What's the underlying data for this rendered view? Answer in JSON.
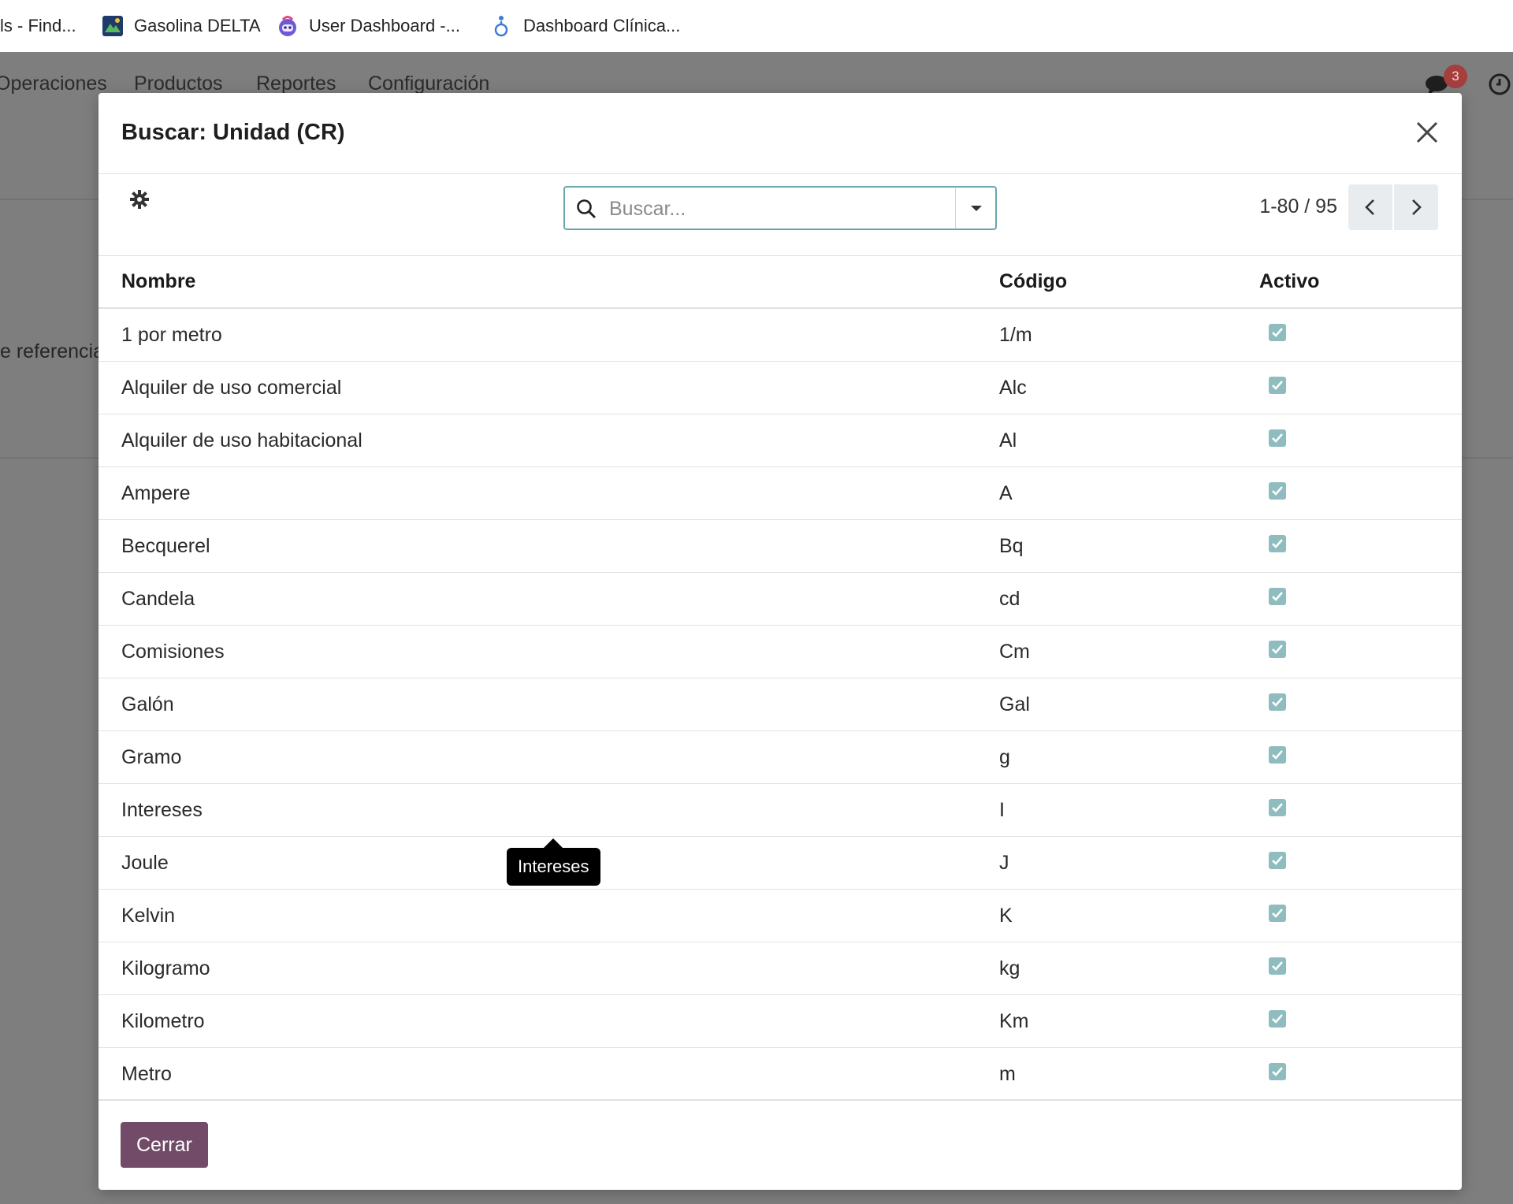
{
  "browser": {
    "bookmarks": [
      {
        "label": "ls - Find..."
      },
      {
        "label": "Gasolina DELTA"
      },
      {
        "label": "User Dashboard -..."
      },
      {
        "label": "Dashboard Clínica..."
      }
    ]
  },
  "app": {
    "menu": [
      "Operaciones",
      "Productos",
      "Reportes",
      "Configuración"
    ],
    "notification_count": "3",
    "background_text": "e referencia"
  },
  "dialog": {
    "title": "Buscar: Unidad (CR)",
    "search_placeholder": "Buscar...",
    "pager": "1-80 / 95",
    "columns": {
      "name": "Nombre",
      "code": "Código",
      "active": "Activo"
    },
    "rows": [
      {
        "name": "1 por metro",
        "code": "1/m",
        "active": true
      },
      {
        "name": "Alquiler de uso comercial",
        "code": "Alc",
        "active": true
      },
      {
        "name": "Alquiler de uso habitacional",
        "code": "Al",
        "active": true
      },
      {
        "name": "Ampere",
        "code": "A",
        "active": true
      },
      {
        "name": "Becquerel",
        "code": "Bq",
        "active": true
      },
      {
        "name": "Candela",
        "code": "cd",
        "active": true
      },
      {
        "name": "Comisiones",
        "code": "Cm",
        "active": true
      },
      {
        "name": "Galón",
        "code": "Gal",
        "active": true
      },
      {
        "name": "Gramo",
        "code": "g",
        "active": true
      },
      {
        "name": "Intereses",
        "code": "I",
        "active": true
      },
      {
        "name": "Joule",
        "code": "J",
        "active": true
      },
      {
        "name": "Kelvin",
        "code": "K",
        "active": true
      },
      {
        "name": "Kilogramo",
        "code": "kg",
        "active": true
      },
      {
        "name": "Kilometro",
        "code": "Km",
        "active": true
      },
      {
        "name": "Metro",
        "code": "m",
        "active": true
      }
    ],
    "tooltip": "Intereses",
    "close_button": "Cerrar"
  },
  "colors": {
    "primary": "#714b67",
    "checkbox": "#8fbcbf",
    "search_border": "#6aa7aa",
    "badge": "#a63e3e"
  },
  "icons": [
    "map-icon",
    "robot-icon",
    "figure-icon",
    "chat-icon",
    "clock-icon",
    "gear-icon",
    "search-icon",
    "caret-down-icon",
    "chevron-left-icon",
    "chevron-right-icon",
    "close-icon",
    "check-icon"
  ]
}
